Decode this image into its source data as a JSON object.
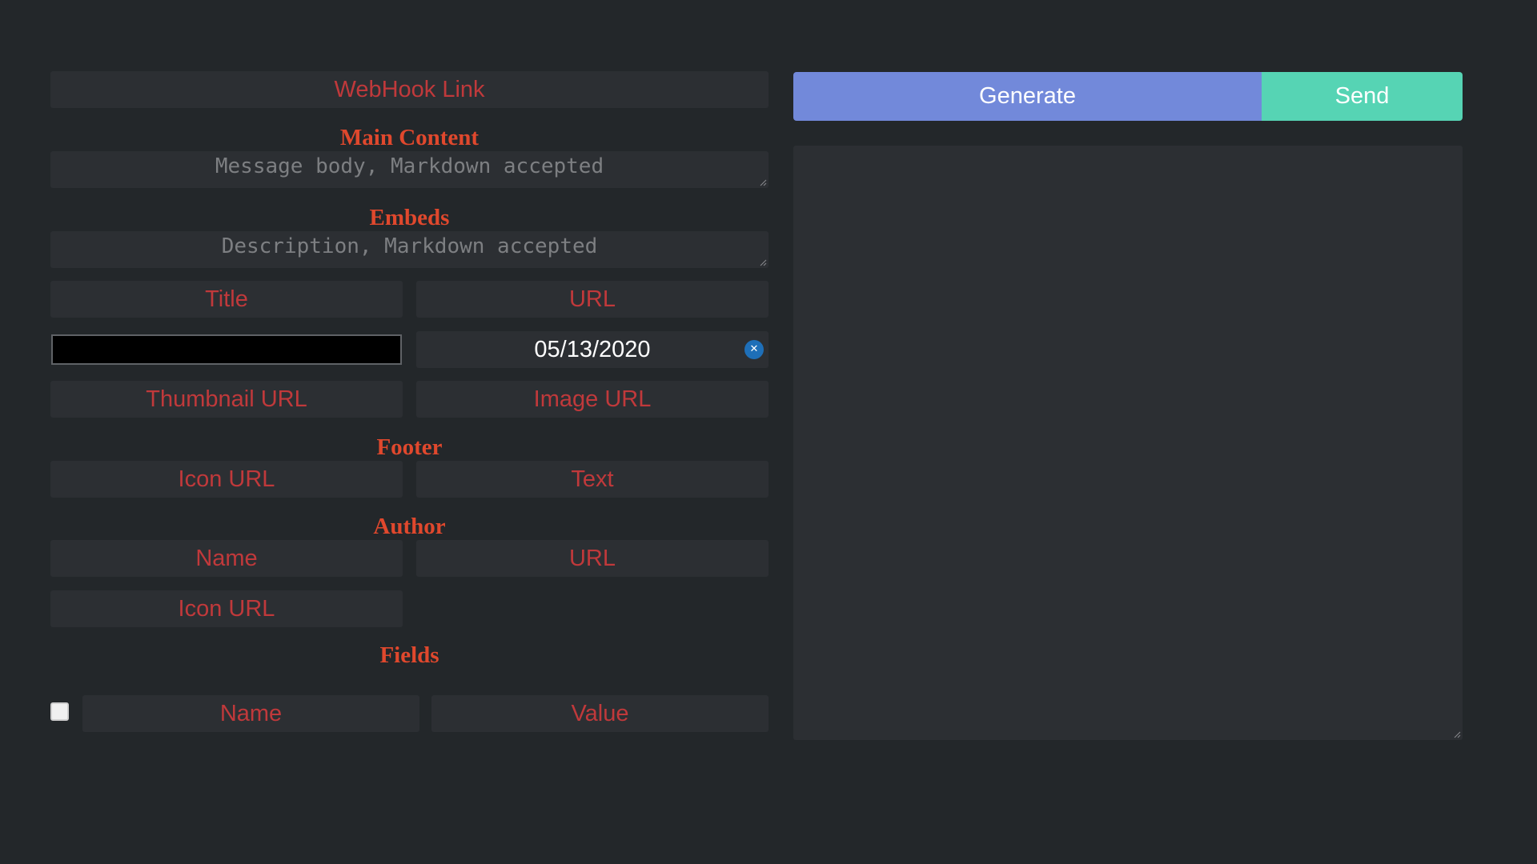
{
  "webhook": {
    "placeholder": "WebHook Link"
  },
  "main_content": {
    "heading": "Main Content",
    "placeholder": "Message body, Markdown accepted"
  },
  "embeds": {
    "heading": "Embeds",
    "description_placeholder": "Description, Markdown accepted",
    "title_placeholder": "Title",
    "url_placeholder": "URL",
    "color_value": "#000000",
    "date_value": "05/13/2020",
    "thumbnail_placeholder": "Thumbnail URL",
    "image_placeholder": "Image URL"
  },
  "footer": {
    "heading": "Footer",
    "icon_url_placeholder": "Icon URL",
    "text_placeholder": "Text"
  },
  "author": {
    "heading": "Author",
    "name_placeholder": "Name",
    "url_placeholder": "URL",
    "icon_url_placeholder": "Icon URL"
  },
  "fields": {
    "heading": "Fields",
    "inline_checked": false,
    "name_placeholder": "Name",
    "value_placeholder": "Value"
  },
  "actions": {
    "generate_label": "Generate",
    "send_label": "Send"
  },
  "colors": {
    "background": "#23272a",
    "input_background": "#2c2f33",
    "placeholder_red": "#c0393b",
    "heading_orange": "#e0482d",
    "generate_blurple": "#7289da",
    "send_green": "#56d4b4"
  }
}
